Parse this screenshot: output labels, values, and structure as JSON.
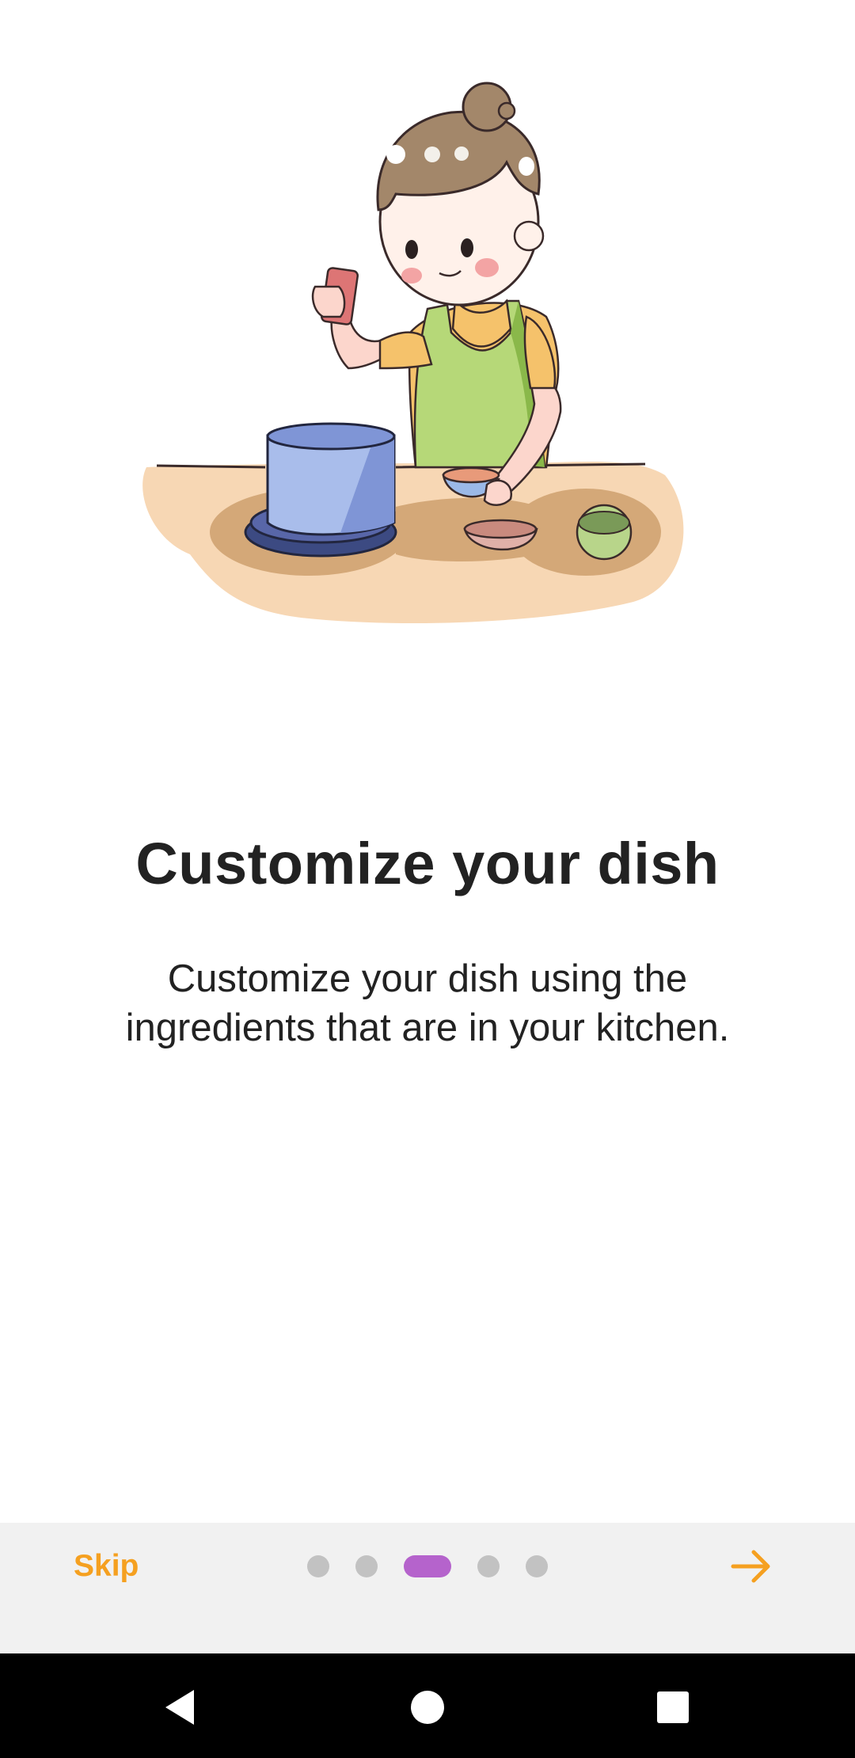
{
  "onboarding": {
    "title": "Customize your dish",
    "description": "Customize your dish using the ingredients that are in your kitchen.",
    "illustration": "woman-cooking-illustration"
  },
  "footer": {
    "skip_label": "Skip",
    "page_count": 5,
    "current_page": 3,
    "next_icon": "arrow-right-icon",
    "accent_color": "#f5a020",
    "active_dot_color": "#b563cc"
  },
  "system_nav": {
    "back_icon": "back-triangle-icon",
    "home_icon": "home-circle-icon",
    "recents_icon": "recents-square-icon"
  }
}
